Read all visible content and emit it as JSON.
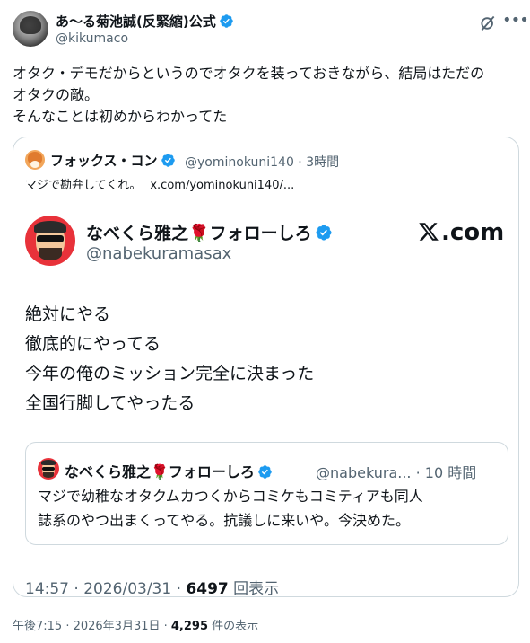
{
  "author": {
    "name": "あ〜る菊池誠(反緊縮)公式",
    "handle": "@kikumaco"
  },
  "tweet_text": "オタク・デモだからというのでオタクを装っておきながら、結局はただの\nオタクの敵。\nそんなことは初めからわかってた",
  "quote": {
    "name": "フォックス・コン",
    "meta": "@yominokuni140 · 3時間",
    "text": "マジで勘弁してくれ。",
    "link": "x.com/yominokuni140/..."
  },
  "embedded": {
    "name": "なべくら雅之🌹フォローしろ",
    "handle": "@nabekuramasax",
    "site": ".com",
    "body": "絶対にやる\n徹底的にやってる\n今年の俺のミッション完全に決まった\n全国行脚してやったる",
    "inner": {
      "name": "なべくら雅之🌹フォローしろ",
      "meta": "@nabekura... · 10 時間",
      "text": "マジで幼稚なオタクムカつくからコミケもコミティアも同人\n誌系のやつ出まくってやる。抗議しに来いや。今決めた。"
    },
    "footer_time": "14:57 · 2026/03/31 · ",
    "footer_views": "6497",
    "footer_views_label": " 回表示"
  },
  "bottom": {
    "time": "午後7:15 · 2026年3月31日 · ",
    "views": "4,295",
    "views_label": " 件の表示"
  },
  "colors": {
    "verified": "#1d9bf0",
    "muted": "#536471",
    "border": "#cfd9de"
  }
}
